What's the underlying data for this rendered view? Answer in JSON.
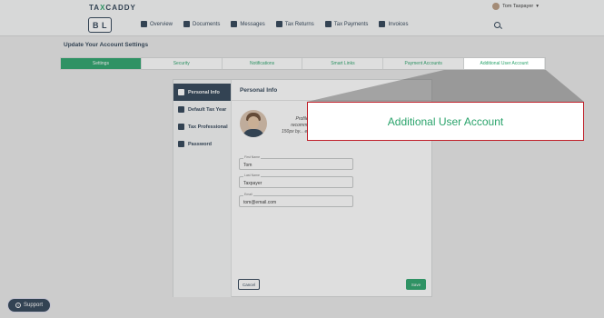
{
  "app": {
    "brand_prefix": "TA",
    "brand_x": "X",
    "brand_suffix": "CADDY",
    "logo_text": "B L"
  },
  "user": {
    "name": "Tom Taxpayer"
  },
  "nav": [
    {
      "label": "Overview",
      "icon": "home-icon"
    },
    {
      "label": "Documents",
      "icon": "documents-icon"
    },
    {
      "label": "Messages",
      "icon": "messages-icon"
    },
    {
      "label": "Tax Returns",
      "icon": "tax-returns-icon"
    },
    {
      "label": "Tax Payments",
      "icon": "tax-payments-icon"
    },
    {
      "label": "Invoices",
      "icon": "invoices-icon"
    }
  ],
  "page": {
    "title": "Update Your Account Settings"
  },
  "tabs": [
    "Settings",
    "Security",
    "Notifications",
    "Smart Links",
    "Payment Accounts",
    "Additional User Account"
  ],
  "sidebar": [
    {
      "label": "Personal Info",
      "icon": "person-icon"
    },
    {
      "label": "Default Tax Year",
      "icon": "calendar-icon"
    },
    {
      "label": "Tax Professional",
      "icon": "briefcase-icon"
    },
    {
      "label": "Password",
      "icon": "lock-icon"
    }
  ],
  "content": {
    "title": "Personal Info",
    "profile_text": "Profile p... recommen... 150px by... either a ..."
  },
  "form": {
    "first_name_label": "First Name",
    "first_name_value": "Tom",
    "last_name_label": "Last Name",
    "last_name_value": "Taxpayer",
    "email_label": "Email",
    "email_value": "tom@email.com"
  },
  "buttons": {
    "cancel": "Cancel",
    "save": "Save",
    "support": "Support"
  },
  "callout": {
    "text": "Additional User Account"
  },
  "colors": {
    "brand_green": "#2aa36b",
    "navy": "#2f4256",
    "callout_border": "#c0202a"
  }
}
